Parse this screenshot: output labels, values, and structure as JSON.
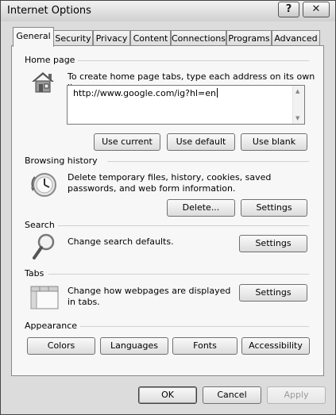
{
  "window": {
    "title": "Internet Options",
    "help_glyph": "?",
    "close_glyph": "✕"
  },
  "tabs": [
    "General",
    "Security",
    "Privacy",
    "Content",
    "Connections",
    "Programs",
    "Advanced"
  ],
  "home_page": {
    "label": "Home page",
    "description": "To create home page tabs, type each address on its own line.",
    "url": "http://www.google.com/ig?hl=en",
    "buttons": {
      "use_current": "Use current",
      "use_default": "Use default",
      "use_blank": "Use blank"
    }
  },
  "browsing_history": {
    "label": "Browsing history",
    "description": "Delete temporary files, history, cookies, saved passwords, and web form information.",
    "buttons": {
      "delete": "Delete...",
      "settings": "Settings"
    }
  },
  "search": {
    "label": "Search",
    "description": "Change search defaults.",
    "buttons": {
      "settings": "Settings"
    }
  },
  "tabs_section": {
    "label": "Tabs",
    "description": "Change how webpages are displayed in tabs.",
    "buttons": {
      "settings": "Settings"
    }
  },
  "appearance": {
    "label": "Appearance",
    "buttons": {
      "colors": "Colors",
      "languages": "Languages",
      "fonts": "Fonts",
      "accessibility": "Accessibility"
    }
  },
  "footer": {
    "ok": "OK",
    "cancel": "Cancel",
    "apply": "Apply"
  },
  "icons": {
    "home": "house-icon",
    "history": "clock-icon",
    "search": "magnifier-icon",
    "tabs": "tabs-icon"
  }
}
